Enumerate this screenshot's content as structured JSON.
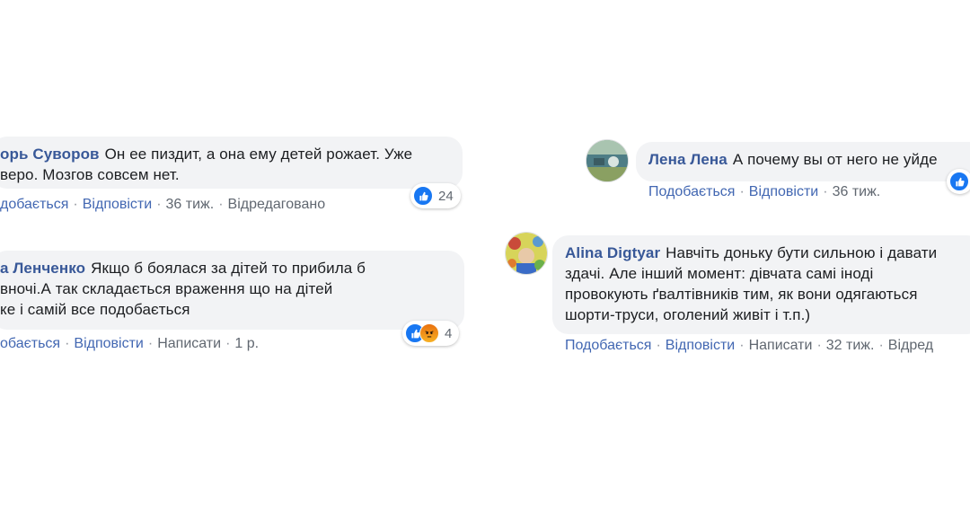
{
  "comments": [
    {
      "author": "орь Суворов",
      "text": "Он ее пиздит, а она ему детей рожает. Уже\nверо. Мозгов совсем нет.",
      "actions": {
        "like": "добається",
        "reply": "Відповісти",
        "time": "36 тиж.",
        "edited": "Відредаговано"
      },
      "reactions": {
        "icons": [
          "like-icon"
        ],
        "count": "24"
      }
    },
    {
      "author": "а Ленченко",
      "text": "Якщо б боялася за дітей то прибила б\nвночі.А так складається враження що на дітей\nке і самій все подобається",
      "actions": {
        "like": "обається",
        "reply": "Відповісти",
        "write": "Написати",
        "time": "1 р."
      },
      "reactions": {
        "icons": [
          "like-icon",
          "angry-icon"
        ],
        "count": "4"
      }
    },
    {
      "author": "Лена Лена",
      "text": "А почему вы от него не уйде",
      "actions": {
        "like": "Подобається",
        "reply": "Відповісти",
        "time": "36 тиж."
      },
      "reactions": {
        "icons": [
          "like-icon"
        ]
      },
      "avatar": "avatar-photo"
    },
    {
      "author": "Alina Digtyar",
      "text": "Навчіть доньку бути сильною і давати\nздачі. Але інший момент: дівчата самі іноді\nпровокують ґвалтівників тим, як вони одягаються\nшорти-труси, оголений живіт і т.п.)",
      "actions": {
        "like": "Подобається",
        "reply": "Відповісти",
        "write": "Написати",
        "time": "32 тиж.",
        "edited": "Відред"
      },
      "avatar": "avatar-photo"
    }
  ],
  "colors": {
    "author": "#385898",
    "link": "#4267b2",
    "bubble": "#f2f3f5",
    "like": "#1877f2"
  }
}
